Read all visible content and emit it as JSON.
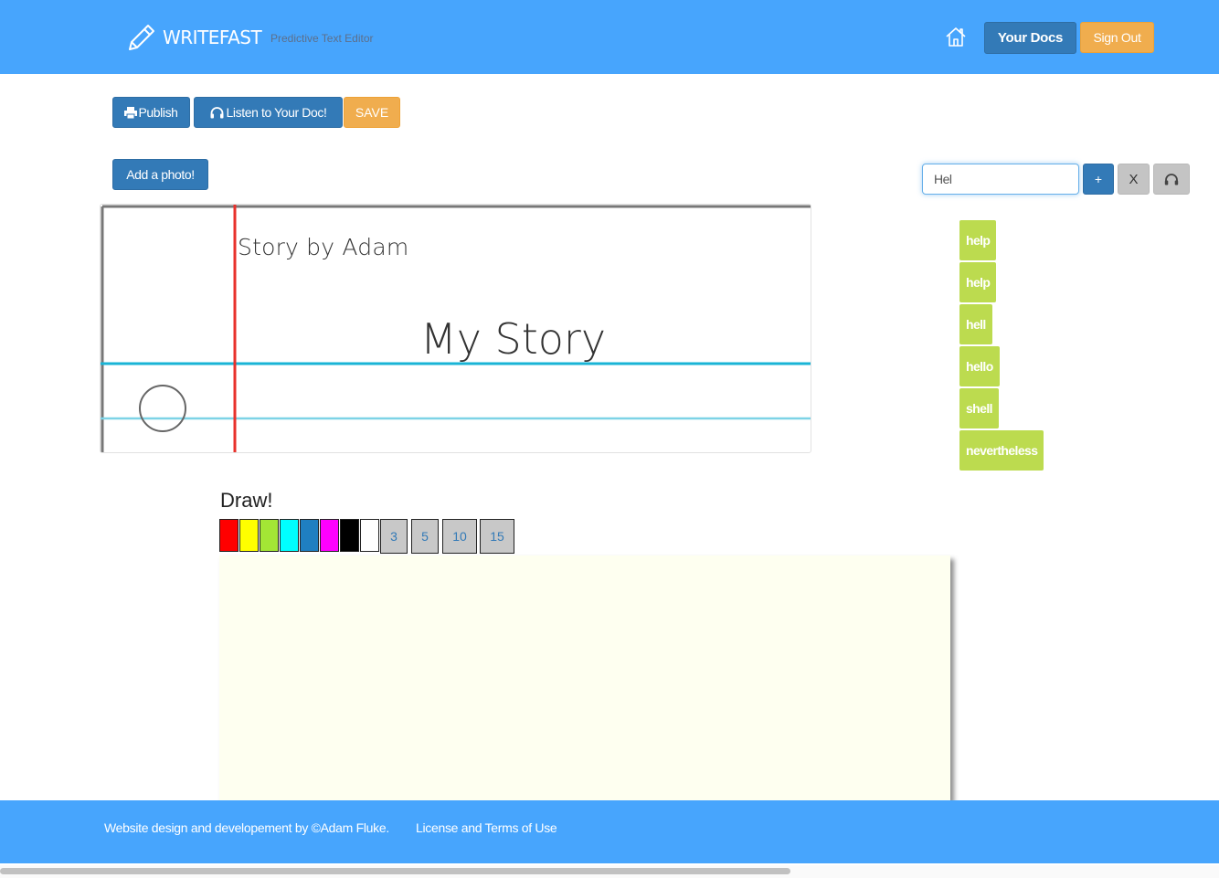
{
  "navbar": {
    "brand": "WRITEFAST",
    "tagline": "Predictive Text Editor",
    "your_docs": "Your Docs",
    "sign_out": "Sign Out",
    "icons": {
      "brand": "pencil-icon",
      "home": "home-icon"
    }
  },
  "toolbar": {
    "publish": "Publish",
    "listen": "Listen to Your Doc!",
    "save": "SAVE",
    "add_photo": "Add a photo!"
  },
  "document": {
    "author_line": "Story by Adam",
    "title": "My Story"
  },
  "word_entry": {
    "value": "Hel",
    "add_label": "+",
    "clear_label": "X"
  },
  "suggestions": [
    "help",
    "help",
    "hell",
    "hello",
    "shell",
    "nevertheless"
  ],
  "draw": {
    "heading": "Draw!",
    "colors": [
      "#ff0000",
      "#ffff00",
      "#a3e635",
      "#00ffff",
      "#1f7fc1",
      "#ff00ff",
      "#000000",
      "#ffffff"
    ],
    "sizes": [
      "3",
      "5",
      "10",
      "15"
    ],
    "canvas_color": "#fefff0"
  },
  "footer": {
    "credit": "Website design and developement by ©Adam Fluke.",
    "license": "License and Terms of Use"
  },
  "colors": {
    "nav": "#47a5fd",
    "primary": "#337ab7",
    "warning": "#f0ad4e",
    "suggestion": "#bcdb4f"
  }
}
